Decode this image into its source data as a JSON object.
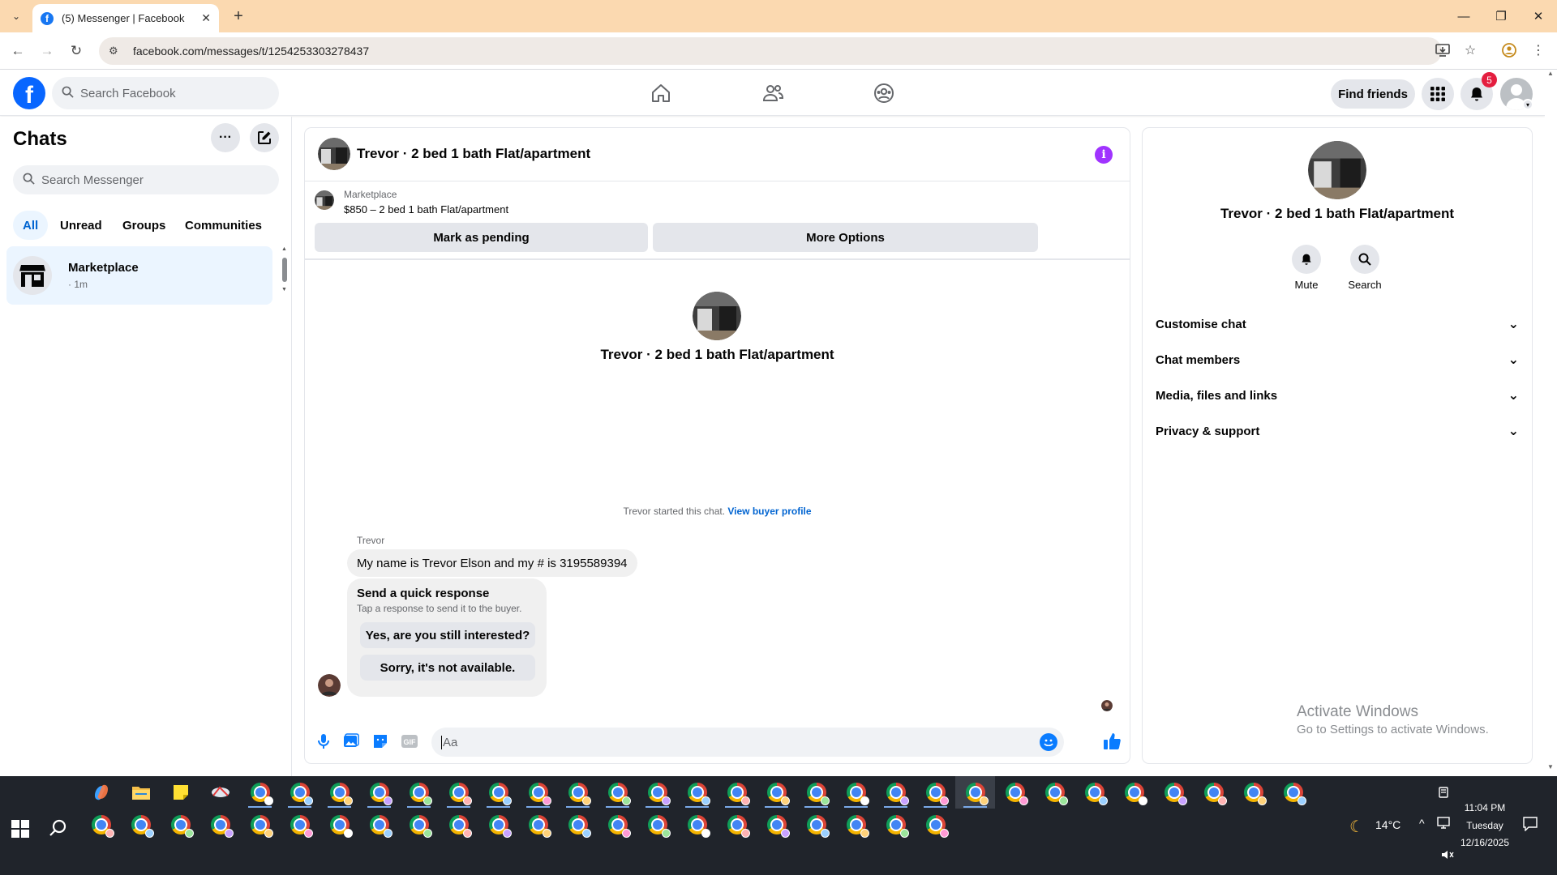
{
  "browser": {
    "tab_title": "(5) Messenger | Facebook",
    "url": "facebook.com/messages/t/1254253303278437"
  },
  "fb": {
    "search_placeholder": "Search Facebook",
    "find_friends": "Find friends",
    "notification_count": "5"
  },
  "chats": {
    "title": "Chats",
    "search_placeholder": "Search Messenger",
    "filters": [
      "All",
      "Unread",
      "Groups",
      "Communities"
    ],
    "items": [
      {
        "name": "Marketplace",
        "time": "· 1m"
      }
    ]
  },
  "conversation": {
    "title": "Trevor · 2 bed 1 bath Flat/apartment",
    "marketplace_label": "Marketplace",
    "listing": "$850 – 2 bed 1 bath Flat/apartment",
    "mark_pending": "Mark as pending",
    "more_options": "More Options",
    "hero_name": "Trevor · 2 bed 1 bath Flat/apartment",
    "started_text": "Trevor started this chat.",
    "view_buyer_profile": "View buyer profile",
    "sender": "Trevor",
    "message": "My name is Trevor Elson and my # is 3195589394",
    "quick_response": {
      "title": "Send a quick response",
      "subtitle": "Tap a response to send it to the buyer.",
      "options": [
        "Yes, are you still interested?",
        "Sorry, it's not available."
      ]
    },
    "composer_placeholder": "Aa"
  },
  "info_panel": {
    "name": "Trevor · 2 bed 1 bath Flat/apartment",
    "actions": [
      "Mute",
      "Search"
    ],
    "sections": [
      "Customise chat",
      "Chat members",
      "Media, files and links",
      "Privacy & support"
    ]
  },
  "watermark": {
    "line1": "Activate Windows",
    "line2": "Go to Settings to activate Windows."
  },
  "taskbar": {
    "weather": "14°C",
    "time": "11:04 PM",
    "day": "Tuesday",
    "date": "12/16/2025"
  },
  "colors": {
    "facebook_blue": "#0866ff",
    "messenger_blue": "#0a7cff",
    "info_purple": "#a033ff",
    "tabbar": "#fbd9b0",
    "taskbar": "#20242b"
  }
}
